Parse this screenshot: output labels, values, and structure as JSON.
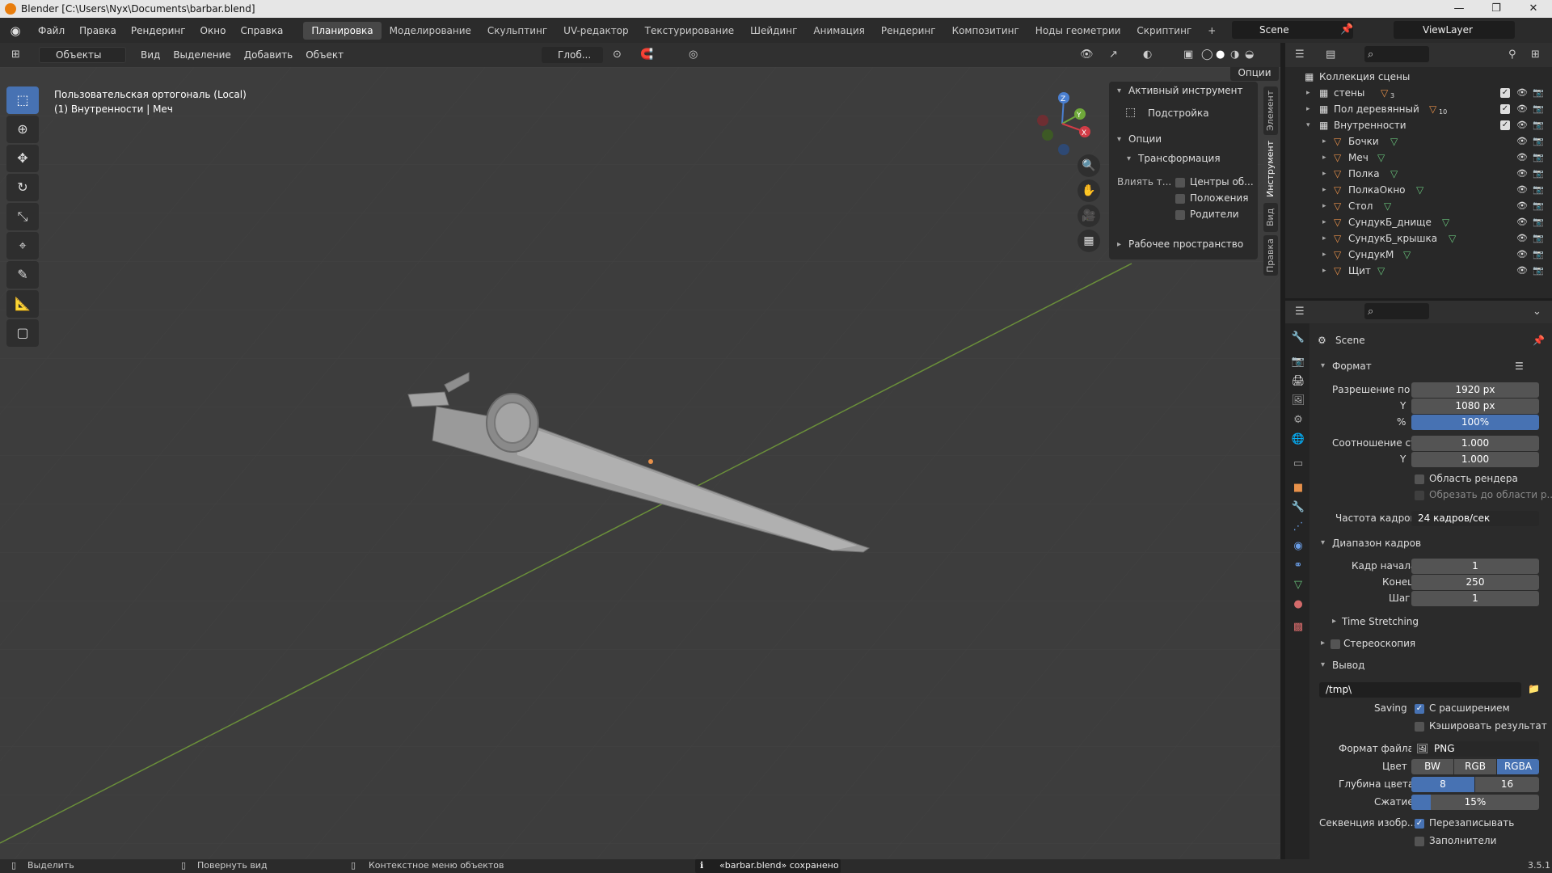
{
  "window": {
    "title": "Blender [C:\\Users\\Nyx\\Documents\\barbar.blend]",
    "controls": [
      "—",
      "❐",
      "✕"
    ]
  },
  "topbar": {
    "menus": [
      "Файл",
      "Правка",
      "Рендеринг",
      "Окно",
      "Справка"
    ],
    "workspaces": [
      "Планировка",
      "Моделирование",
      "Скульптинг",
      "UV-редактор",
      "Текстурирование",
      "Шейдинг",
      "Анимация",
      "Рендеринг",
      "Композитинг",
      "Ноды геометрии",
      "Скриптинг",
      "+"
    ],
    "active_workspace": "Планировка",
    "scene": "Scene",
    "view_layer": "ViewLayer"
  },
  "viewport_header": {
    "mode": "Объекты",
    "menus": [
      "Вид",
      "Выделение",
      "Добавить",
      "Объект"
    ],
    "orientation": "Глоб...",
    "options": "Опции"
  },
  "viewport": {
    "info_line1": "Пользовательская ортогональ (Local)",
    "info_line2": "(1) Внутренности | Меч",
    "gizmo": {
      "z": "Z",
      "y": "Y",
      "x": "X"
    }
  },
  "npanel": {
    "active_tool_header": "Активный инструмент",
    "active_tool": "Подстройка",
    "options_header": "Опции",
    "transform_header": "Трансформация",
    "affect_label": "Влиять т...",
    "affect_items": [
      "Центры об...",
      "Положения",
      "Родители"
    ],
    "workspace_header": "Рабочее пространство",
    "tabs": [
      "Элемент",
      "Инструмент",
      "Вид",
      "Правка"
    ],
    "active_tab": "Инструмент"
  },
  "outliner": {
    "root": "Коллекция сцены",
    "collections": [
      {
        "name": "стены",
        "badge": "3"
      },
      {
        "name": "Пол деревянный",
        "badge": "10"
      },
      {
        "name": "Внутренности",
        "badge": ""
      }
    ],
    "objects": [
      "Бочки",
      "Меч",
      "Полка",
      "ПолкаОкно",
      "Стол",
      "СундукБ_днище",
      "СундукБ_крышка",
      "СундукМ",
      "Щит"
    ]
  },
  "properties": {
    "scene": "Scene",
    "format": {
      "header": "Формат",
      "res_x_label": "Разрешение по X",
      "res_x": "1920 px",
      "res_y_label": "Y",
      "res_y": "1080 px",
      "pct_label": "%",
      "pct": "100%",
      "aspect_label": "Соотношение ст...",
      "aspect_x": "1.000",
      "aspect_y_label": "Y",
      "aspect_y": "1.000",
      "render_region": "Область рендера",
      "crop": "Обрезать до области р...",
      "fps_label": "Частота кадров",
      "fps": "24 кадров/сек"
    },
    "frame_range": {
      "header": "Диапазон кадров",
      "start_label": "Кадр начала",
      "start": "1",
      "end_label": "Конец",
      "end": "250",
      "step_label": "Шаг",
      "step": "1"
    },
    "time_stretching": "Time Stretching",
    "stereoscopy": "Стереоскопия",
    "output": {
      "header": "Вывод",
      "path": "/tmp\\",
      "saving_label": "Saving",
      "file_ext": "С расширением",
      "cache": "Кэшировать результат",
      "file_format_label": "Формат файла",
      "file_format": "PNG",
      "color_label": "Цвет",
      "color_modes": [
        "BW",
        "RGB",
        "RGBA"
      ],
      "color_active": "RGBA",
      "depth_label": "Глубина цвета",
      "depth_options": [
        "8",
        "16"
      ],
      "depth_active": "8",
      "compression_label": "Сжатие",
      "compression": "15%",
      "compression_fraction": 0.15,
      "sequence_label": "Секвенция изобр...",
      "overwrite": "Перезаписывать",
      "placeholders": "Заполнители"
    }
  },
  "statusbar": {
    "select": "Выделить",
    "rotate": "Повернуть вид",
    "context": "Контекстное меню объектов",
    "saved": "«barbar.blend» сохранено",
    "version": "3.5.1"
  }
}
